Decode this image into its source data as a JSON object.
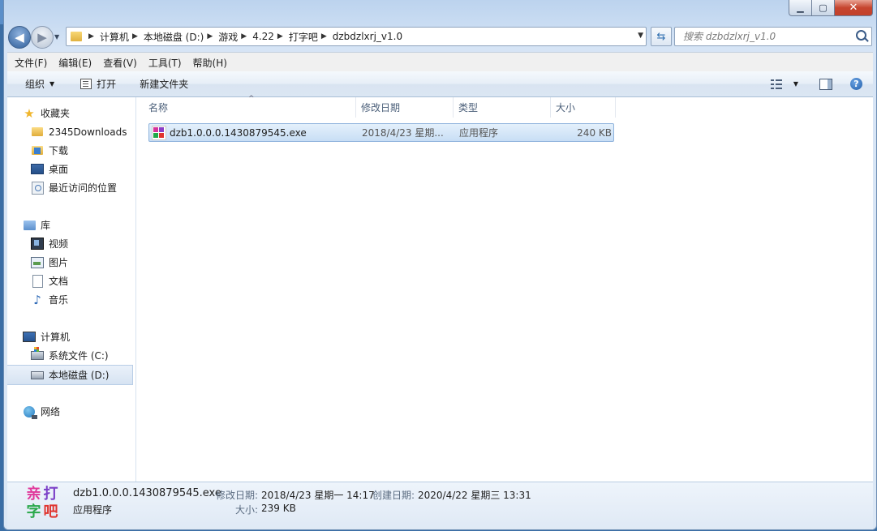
{
  "window": {
    "caption": {
      "minimize": "▁",
      "maximize": "▢",
      "close": "✕"
    }
  },
  "address": {
    "crumbs": [
      "计算机",
      "本地磁盘 (D:)",
      "游戏",
      "4.22",
      "打字吧",
      "dzbdzlxrj_v1.0"
    ],
    "search_placeholder": "搜索 dzbdzlxrj_v1.0"
  },
  "menubar": {
    "file": "文件(F)",
    "edit": "编辑(E)",
    "view": "查看(V)",
    "tools": "工具(T)",
    "help": "帮助(H)"
  },
  "toolbar": {
    "organize": "组织",
    "open": "打开",
    "new_folder": "新建文件夹",
    "help_glyph": "?"
  },
  "nav": {
    "favorites": {
      "label": "收藏夹",
      "items": [
        "2345Downloads",
        "下载",
        "桌面",
        "最近访问的位置"
      ]
    },
    "libraries": {
      "label": "库",
      "items": [
        "视频",
        "图片",
        "文档",
        "音乐"
      ]
    },
    "computer": {
      "label": "计算机",
      "items": [
        "系统文件 (C:)",
        "本地磁盘 (D:)"
      ],
      "selected": "本地磁盘 (D:)"
    },
    "network": {
      "label": "网络"
    }
  },
  "columns": {
    "name": "名称",
    "modified": "修改日期",
    "type": "类型",
    "size": "大小"
  },
  "files": [
    {
      "name": "dzb1.0.0.0.1430879545.exe",
      "modified": "2018/4/23 星期...",
      "type": "应用程序",
      "size": "240 KB"
    }
  ],
  "details": {
    "icon_chars": [
      "亲",
      "打",
      "字",
      "吧"
    ],
    "filename": "dzb1.0.0.0.1430879545.exe",
    "filetype": "应用程序",
    "modified_label": "修改日期:",
    "modified_value": "2018/4/23 星期一 14:17",
    "created_label": "创建日期:",
    "created_value": "2020/4/22 星期三 13:31",
    "size_label": "大小:",
    "size_value": "239 KB"
  },
  "colors": {
    "selection": "#cce0f5",
    "accent": "#3b6ea5"
  }
}
